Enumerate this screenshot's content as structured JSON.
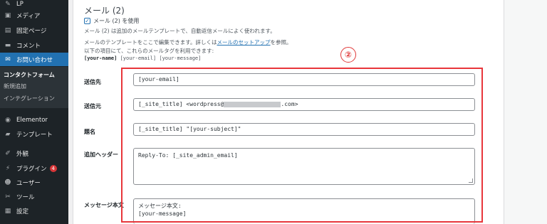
{
  "sidebar": {
    "items": [
      {
        "label": "LP",
        "icon": "pin-icon"
      },
      {
        "label": "メディア",
        "icon": "media-icon"
      },
      {
        "label": "固定ページ",
        "icon": "page-icon"
      },
      {
        "label": "コメント",
        "icon": "comment-icon"
      },
      {
        "label": "お問い合わせ",
        "icon": "mail-icon"
      },
      {
        "label": "Elementor",
        "icon": "elementor-icon"
      },
      {
        "label": "テンプレート",
        "icon": "folder-icon"
      },
      {
        "label": "外観",
        "icon": "brush-icon"
      },
      {
        "label": "プラグイン",
        "icon": "plugin-icon",
        "badge": "4"
      },
      {
        "label": "ユーザー",
        "icon": "user-icon"
      },
      {
        "label": "ツール",
        "icon": "wrench-icon"
      },
      {
        "label": "設定",
        "icon": "settings-icon"
      }
    ],
    "submenu": [
      "コンタクトフォーム",
      "新規追加",
      "インテグレーション"
    ]
  },
  "section": {
    "title": "メール (2)",
    "use_label": "メール (2) を使用",
    "desc1": "メール (2) は追加のメールテンプレートで、自動返信メールによく使われます。",
    "desc2_pre": "メールのテンプレートをここで編集できます。詳しくは",
    "desc2_link": "メールのセットアップ",
    "desc2_post": "を参照。",
    "desc3": "以下の項目にて、これらのメールタグを利用できます:",
    "tag_bold": "[your-name]",
    "tag_rest": " [your-email] [your-message]"
  },
  "annotation": {
    "number": "②",
    "color": "#e8363b"
  },
  "form": {
    "to_label": "送信先",
    "to_value": "[your-email]",
    "from_label": "送信元",
    "from_pre": "[_site_title] <wordpress@",
    "from_post": ".com>",
    "subject_label": "題名",
    "subject_value": "[_site_title] \"[your-subject]\"",
    "headers_label": "追加ヘッダー",
    "headers_value": "Reply-To: [_site_admin_email]",
    "body_label": "メッセージ本文",
    "body_value": "メッセージ本文:\n[your-message]"
  },
  "colors": {
    "sidebar_bg": "#1d2327",
    "active": "#2271b1",
    "accent_red": "#e8363b"
  }
}
